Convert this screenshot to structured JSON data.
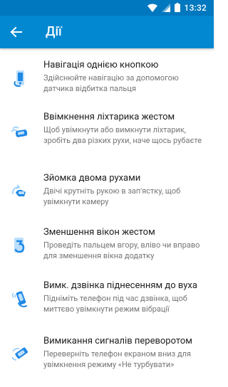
{
  "status_bar": {
    "time": "13:32"
  },
  "app_bar": {
    "title": "Дії"
  },
  "actions": [
    {
      "title": "Навігація однією кнопкою",
      "description": "Здійснюйте навігацію за допомогою датчика відбитка пальця",
      "icon": "fingerprint-nav-icon"
    },
    {
      "title": "Ввімкнення ліхтарика жестом",
      "description": "Щоб увімкнути або вимкнути ліхтарик, зробіть два різких рухи, наче щось рубаєте",
      "icon": "chop-gesture-icon"
    },
    {
      "title": "Зйомка двома рухами",
      "description": "Двічі крутніть рукою в зап'ястку, щоб увімкнути камеру",
      "icon": "twist-gesture-icon"
    },
    {
      "title": "Зменшення вікон жестом",
      "description": "Проведіть пальцем вгору, вліво чи вправо для зменшення вікна додатку",
      "icon": "swipe-shrink-icon"
    },
    {
      "title": "Вимк. дзвінка піднесенням до вуха",
      "description": "Підніміть телефон під час дзвінка, щоб миттєво увімкнути режим вібрації",
      "icon": "lift-to-silence-icon"
    },
    {
      "title": "Вимикання сигналів переворотом",
      "description": "Переверніть телефон екраном вниз для увімкнення режиму «Не турбувати»",
      "icon": "flip-dnd-icon"
    }
  ],
  "colors": {
    "status_bar": "#0078bf",
    "app_bar": "#0288d1",
    "icon_blue": "#1e88e5",
    "title_text": "#212121",
    "subtitle_text": "#757575"
  }
}
